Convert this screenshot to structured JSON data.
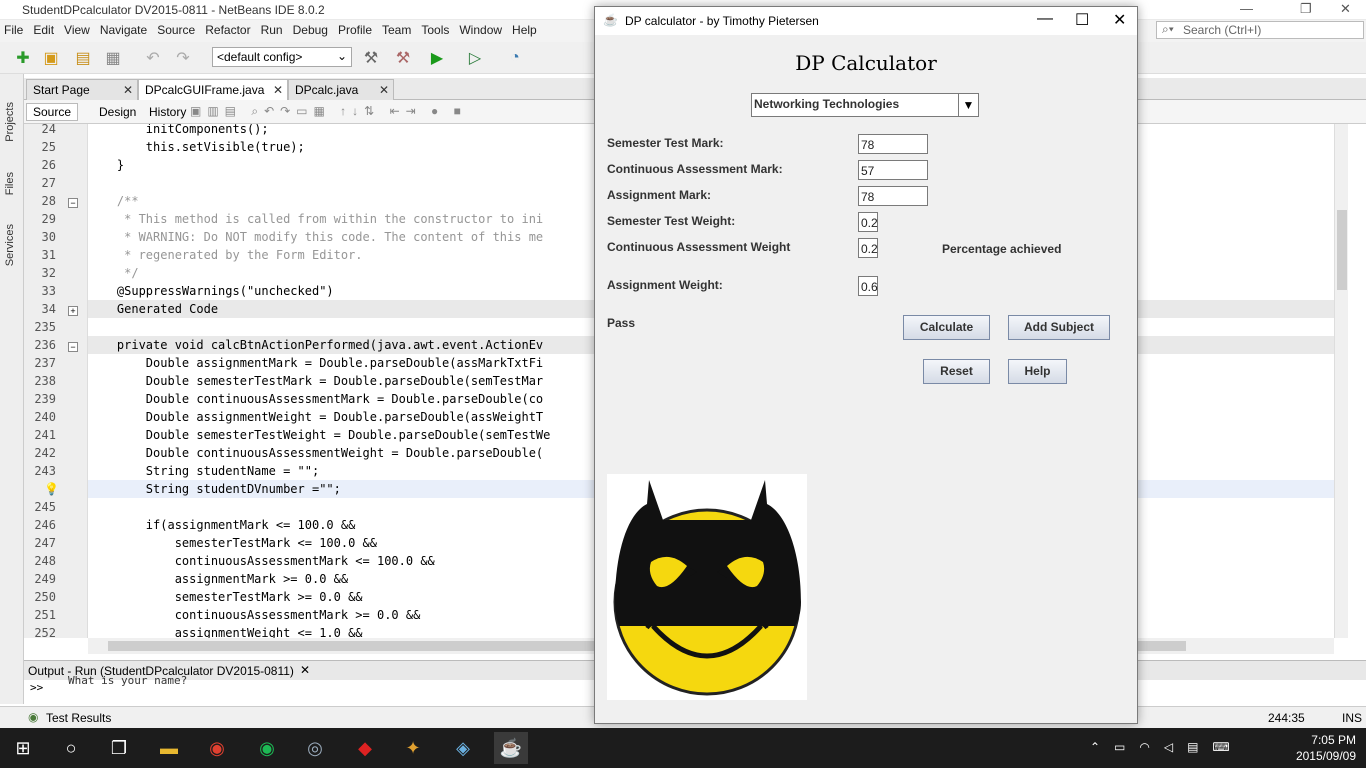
{
  "netbeans": {
    "title": "StudentDPcalculator DV2015-0811 - NetBeans IDE 8.0.2",
    "menu": [
      "File",
      "Edit",
      "View",
      "Navigate",
      "Source",
      "Refactor",
      "Run",
      "Debug",
      "Profile",
      "Team",
      "Tools",
      "Window",
      "Help"
    ],
    "config": "<default config>",
    "search_placeholder": "Search (Ctrl+I)",
    "side_tabs": [
      "Projects",
      "Files",
      "Services"
    ],
    "file_tabs": [
      {
        "label": "Start Page"
      },
      {
        "label": "DPcalcGUIFrame.java"
      },
      {
        "label": "DPcalc.java"
      }
    ],
    "editor_tabs": [
      "Source",
      "Design",
      "History"
    ],
    "code_lines": [
      {
        "n": "24",
        "text": "        initComponents();"
      },
      {
        "n": "25",
        "text": "        this.setVisible(true);"
      },
      {
        "n": "26",
        "text": "    }"
      },
      {
        "n": "27",
        "text": ""
      },
      {
        "n": "28",
        "text": "    /**"
      },
      {
        "n": "29",
        "text": "     * This method is called from within the constructor to ini"
      },
      {
        "n": "30",
        "text": "     * WARNING: Do NOT modify this code. The content of this me"
      },
      {
        "n": "31",
        "text": "     * regenerated by the Form Editor."
      },
      {
        "n": "32",
        "text": "     */"
      },
      {
        "n": "33",
        "text": "    @SuppressWarnings(\"unchecked\")"
      },
      {
        "n": "34",
        "text": "    Generated Code"
      },
      {
        "n": "235",
        "text": ""
      },
      {
        "n": "236",
        "text": "    private void calcBtnActionPerformed(java.awt.event.ActionEv"
      },
      {
        "n": "237",
        "text": "        Double assignmentMark = Double.parseDouble(assMarkTxtFi"
      },
      {
        "n": "238",
        "text": "        Double semesterTestMark = Double.parseDouble(semTestMar"
      },
      {
        "n": "239",
        "text": "        Double continuousAssessmentMark = Double.parseDouble(co"
      },
      {
        "n": "240",
        "text": "        Double assignmentWeight = Double.parseDouble(assWeightT"
      },
      {
        "n": "241",
        "text": "        Double semesterTestWeight = Double.parseDouble(semTestWe"
      },
      {
        "n": "242",
        "text": "        Double continuousAssessmentWeight = Double.parseDouble("
      },
      {
        "n": "243",
        "text": "        String studentName = \"\";"
      },
      {
        "n": "",
        "text": "        String studentDVnumber =\"\";"
      },
      {
        "n": "245",
        "text": ""
      },
      {
        "n": "246",
        "text": "        if(assignmentMark <= 100.0 &&"
      },
      {
        "n": "247",
        "text": "            semesterTestMark <= 100.0 &&"
      },
      {
        "n": "248",
        "text": "            continuousAssessmentMark <= 100.0 &&"
      },
      {
        "n": "249",
        "text": "            assignmentMark >= 0.0 &&"
      },
      {
        "n": "250",
        "text": "            semesterTestMark >= 0.0 &&"
      },
      {
        "n": "251",
        "text": "            continuousAssessmentMark >= 0.0 &&"
      },
      {
        "n": "252",
        "text": "            assignmentWeight <= 1.0 &&"
      }
    ],
    "output_tab": "Output - Run (StudentDPcalculator DV2015-0811)",
    "output_text": "What is your name?",
    "output_prompt": ">>",
    "test_results": "Test Results",
    "position": "244:35",
    "insert_mode": "INS"
  },
  "dp": {
    "title": "DP calculator - by Timothy Pietersen",
    "heading": "DP Calculator",
    "subject": "Networking Technologies",
    "labels": {
      "semester_test_mark": "Semester Test Mark:",
      "ca_mark": "Continuous Assessment Mark:",
      "assignment_mark": "Assignment Mark:",
      "semester_test_weight": "Semester Test Weight:",
      "ca_weight": "Continuous Assessment Weight",
      "assignment_weight": "Assignment Weight:",
      "percentage": "Percentage achieved",
      "result": "Pass"
    },
    "values": {
      "semester_test_mark": "78",
      "ca_mark": "57",
      "assignment_mark": "78",
      "semester_test_weight": "0.2",
      "ca_weight": "0.2",
      "assignment_weight": "0.6"
    },
    "buttons": {
      "calculate": "Calculate",
      "add_subject": "Add Subject",
      "reset": "Reset",
      "help": "Help"
    }
  },
  "taskbar": {
    "time": "7:05 PM",
    "date": "2015/09/09"
  }
}
